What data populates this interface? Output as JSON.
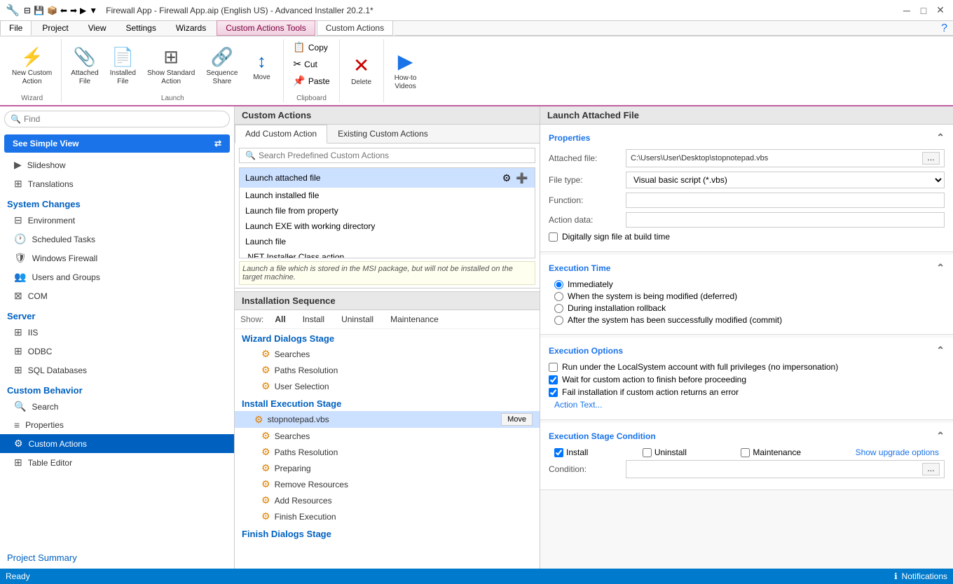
{
  "window": {
    "title": "Firewall App - Firewall App.aip (English US) - Advanced Installer 20.2.1*"
  },
  "ribbon_tabs": {
    "file": "File",
    "project": "Project",
    "view": "View",
    "settings": "Settings",
    "wizards": "Wizards",
    "custom_actions_tools": "Custom Actions Tools",
    "custom_actions_sub": "Custom Actions"
  },
  "toolbar": {
    "new_custom_action": "New Custom\nAction",
    "attached_file": "Attached\nFile",
    "installed_file": "Installed\nFile",
    "show_standard_action": "Show Standard\nAction",
    "sequence_share": "Sequence\nShare",
    "move": "Move",
    "copy": "Copy",
    "cut": "Cut",
    "paste": "Paste",
    "delete": "Delete",
    "how_to_videos": "How-to\nVideos",
    "wizard_label": "Wizard",
    "launch_label": "Launch",
    "clipboard_label": "Clipboard"
  },
  "sidebar": {
    "search_placeholder": "Find",
    "simple_view_btn": "See Simple View",
    "items": [
      {
        "id": "slideshow",
        "label": "Slideshow",
        "icon": "▶"
      },
      {
        "id": "translations",
        "label": "Translations",
        "icon": "⊞"
      }
    ],
    "system_changes": {
      "label": "System Changes",
      "items": [
        {
          "id": "environment",
          "label": "Environment",
          "icon": "⊟"
        },
        {
          "id": "scheduled-tasks",
          "label": "Scheduled Tasks",
          "icon": "🕐"
        },
        {
          "id": "windows-firewall",
          "label": "Windows Firewall",
          "icon": "🛡"
        },
        {
          "id": "users-groups",
          "label": "Users and Groups",
          "icon": "👥"
        },
        {
          "id": "com",
          "label": "COM",
          "icon": "⊠"
        }
      ]
    },
    "server": {
      "label": "Server",
      "items": [
        {
          "id": "iis",
          "label": "IIS",
          "icon": "⊞"
        },
        {
          "id": "odbc",
          "label": "ODBC",
          "icon": "⊞"
        },
        {
          "id": "sql-databases",
          "label": "SQL Databases",
          "icon": "⊞"
        }
      ]
    },
    "custom_behavior": {
      "label": "Custom Behavior",
      "items": [
        {
          "id": "search",
          "label": "Search",
          "icon": "🔍"
        },
        {
          "id": "properties",
          "label": "Properties",
          "icon": "≡"
        },
        {
          "id": "custom-actions",
          "label": "Custom Actions",
          "icon": "⚙",
          "active": true
        },
        {
          "id": "table-editor",
          "label": "Table Editor",
          "icon": "⊞"
        }
      ]
    },
    "project_summary": "Project Summary"
  },
  "custom_actions": {
    "panel_title": "Custom Actions",
    "tab_add": "Add Custom Action",
    "tab_existing": "Existing Custom Actions",
    "search_placeholder": "Search Predefined Custom Actions",
    "action_list": [
      {
        "id": "launch-attached",
        "label": "Launch attached file",
        "selected": true
      },
      {
        "id": "launch-installed",
        "label": "Launch installed file"
      },
      {
        "id": "launch-from-property",
        "label": "Launch file from property"
      },
      {
        "id": "launch-exe-working",
        "label": "Launch EXE with working directory"
      },
      {
        "id": "launch-file",
        "label": "Launch file"
      },
      {
        "id": "net-installer",
        "label": ".NET Installer Class action"
      }
    ],
    "action_description": "Launch a file which is stored in the MSI package, but will not be installed on the target machine."
  },
  "installation_sequence": {
    "panel_title": "Installation Sequence",
    "show_label": "Show:",
    "show_options": [
      "All",
      "Install",
      "Uninstall",
      "Maintenance"
    ],
    "show_active": "All",
    "wizard_dialogs_stage": "Wizard Dialogs Stage",
    "wizard_items": [
      "Searches",
      "Paths Resolution",
      "User Selection"
    ],
    "install_execution_stage": "Install Execution Stage",
    "install_items": [
      {
        "id": "stopnotepad",
        "label": "stopnotepad.vbs",
        "selected": true,
        "move": "Move"
      },
      {
        "id": "searches",
        "label": "Searches"
      },
      {
        "id": "paths-resolution",
        "label": "Paths Resolution"
      },
      {
        "id": "preparing",
        "label": "Preparing"
      },
      {
        "id": "remove-resources",
        "label": "Remove Resources"
      },
      {
        "id": "add-resources",
        "label": "Add Resources"
      },
      {
        "id": "finish-execution",
        "label": "Finish Execution"
      }
    ],
    "finish_dialogs_stage": "Finish Dialogs Stage"
  },
  "right_panel": {
    "header": "Launch Attached File",
    "properties": {
      "title": "Properties",
      "attached_file_label": "Attached file:",
      "attached_file_value": "C:\\Users\\User\\Desktop\\stopnotepad.vbs",
      "file_type_label": "File type:",
      "file_type_value": "Visual basic script (*.vbs)",
      "function_label": "Function:",
      "function_value": "",
      "action_data_label": "Action data:",
      "action_data_value": "",
      "digitally_sign": "Digitally sign file at build time"
    },
    "execution_time": {
      "title": "Execution Time",
      "options": [
        {
          "id": "immediately",
          "label": "Immediately",
          "checked": true
        },
        {
          "id": "deferred",
          "label": "When the system is being modified (deferred)",
          "checked": false
        },
        {
          "id": "rollback",
          "label": "During installation rollback",
          "checked": false
        },
        {
          "id": "commit",
          "label": "After the system has been successfully modified (commit)",
          "checked": false
        }
      ]
    },
    "execution_options": {
      "title": "Execution Options",
      "options": [
        {
          "id": "local-system",
          "label": "Run under the LocalSystem account with full privileges (no impersonation)",
          "checked": false
        },
        {
          "id": "wait-finish",
          "label": "Wait for custom action to finish before proceeding",
          "checked": true
        },
        {
          "id": "fail-install",
          "label": "Fail installation if custom action returns an error",
          "checked": true
        }
      ],
      "action_text": "Action Text..."
    },
    "execution_stage_condition": {
      "title": "Execution Stage Condition",
      "install_label": "Install",
      "install_checked": true,
      "uninstall_label": "Uninstall",
      "uninstall_checked": false,
      "maintenance_label": "Maintenance",
      "maintenance_checked": false,
      "show_upgrade": "Show upgrade options",
      "condition_label": "Condition:"
    }
  },
  "status_bar": {
    "ready": "Ready",
    "notifications": "Notifications"
  }
}
